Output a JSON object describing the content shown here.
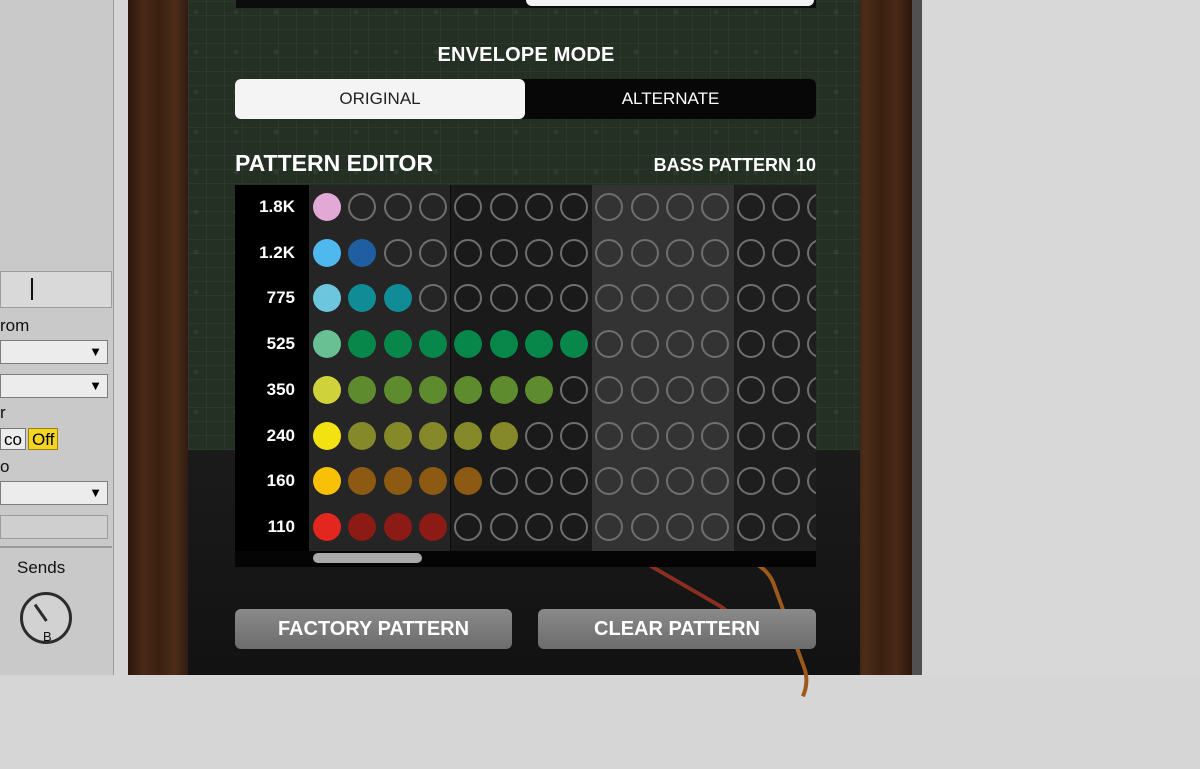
{
  "host_panel": {
    "from_label": "rom",
    "off_chip": "Off",
    "co_chip": "co",
    "r_label": "r",
    "o_label": "o",
    "sends_label": "Sends",
    "knob_letter": "B",
    "off_color": "#f5d426"
  },
  "envelope_mode": {
    "title": "ENVELOPE MODE",
    "options": [
      "ORIGINAL",
      "ALTERNATE"
    ],
    "selected": "ORIGINAL"
  },
  "pattern_editor": {
    "title": "PATTERN EDITOR",
    "pattern_name": "BASS PATTERN 10",
    "rows": [
      {
        "label": "1.8K",
        "active_steps": 1,
        "lead_color": "#e2a9d6",
        "step_color": "#e2a9d6"
      },
      {
        "label": "1.2K",
        "active_steps": 2,
        "lead_color": "#4fb8ee",
        "step_color": "#1f5fa1"
      },
      {
        "label": "775",
        "active_steps": 3,
        "lead_color": "#6cc6dd",
        "step_color": "#108c97"
      },
      {
        "label": "525",
        "active_steps": 8,
        "lead_color": "#69c193",
        "step_color": "#07874a"
      },
      {
        "label": "350",
        "active_steps": 7,
        "lead_color": "#cfd23a",
        "step_color": "#5f8b2f"
      },
      {
        "label": "240",
        "active_steps": 6,
        "lead_color": "#f2e211",
        "step_color": "#86892a"
      },
      {
        "label": "160",
        "active_steps": 5,
        "lead_color": "#f8c007",
        "step_color": "#8c5a12"
      },
      {
        "label": "110",
        "active_steps": 4,
        "lead_color": "#e3271e",
        "step_color": "#8c1a15"
      }
    ],
    "visible_steps": 15
  },
  "buttons": {
    "factory": "FACTORY PATTERN",
    "clear": "CLEAR PATTERN"
  }
}
